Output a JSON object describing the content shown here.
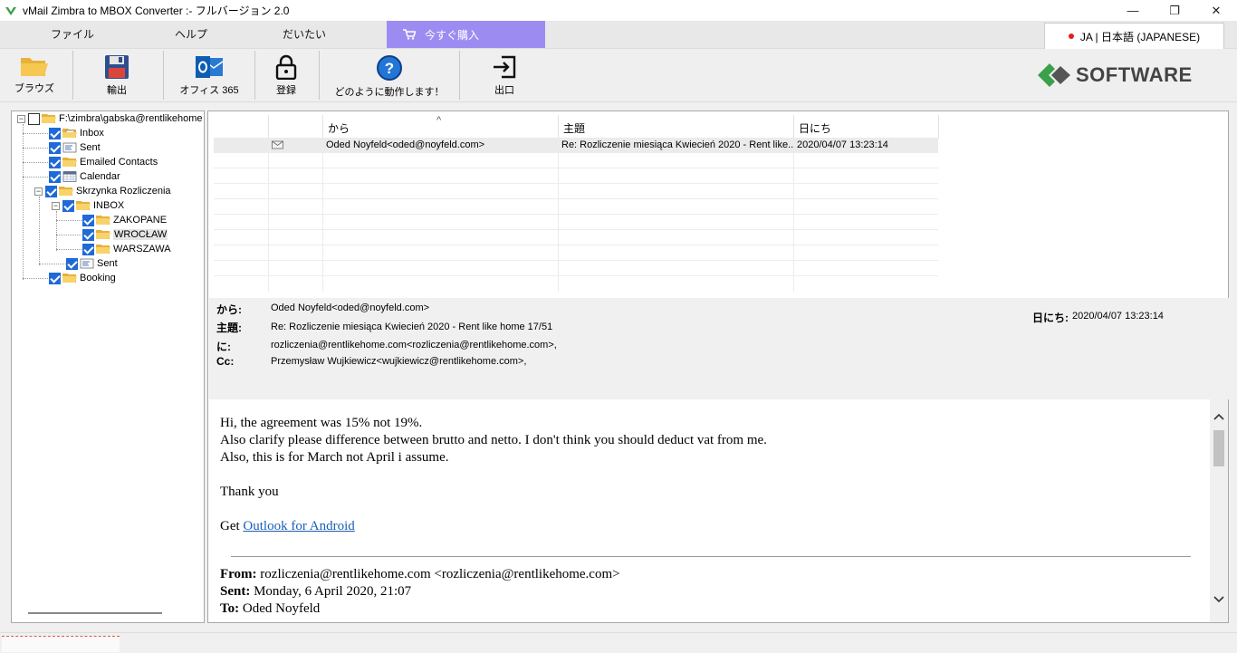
{
  "window": {
    "title": "vMail Zimbra to MBOX Converter :- フルバージョン 2.0",
    "minimize": "—",
    "restore": "❐",
    "close": "✕"
  },
  "menu": {
    "items": [
      "ファイル",
      "ヘルプ",
      "だいたい"
    ],
    "buy_now": "今すぐ購入",
    "language": "JA | 日本語 (JAPANESE)"
  },
  "toolbar": {
    "browse": "ブラウズ",
    "export": "輸出",
    "office365": "オフィス 365",
    "register": "登録",
    "how_it_works": "どのように動作します！",
    "exit": "出口",
    "logo_text": "SOFTWARE"
  },
  "tree": {
    "root": "F:\\zimbra\\gabska@rentlikehome",
    "items": [
      "Inbox",
      "Sent",
      "Emailed Contacts",
      "Calendar",
      "Skrzynka Rozliczenia",
      "INBOX",
      "ZAKOPANE",
      "WROCŁAW",
      "WARSZAWA",
      "Sent",
      "Booking"
    ]
  },
  "grid": {
    "headers": {
      "from": "から",
      "subject": "主題",
      "date": "日にち",
      "sort_indicator": "^"
    },
    "rows": [
      {
        "from": "Oded Noyfeld<oded@noyfeld.com>",
        "subject": "Re: Rozliczenie miesiąca Kwiecień 2020 - Rent like...",
        "date": "2020/04/07 13:23:14"
      }
    ]
  },
  "detail": {
    "from_label": "から:",
    "from": "Oded Noyfeld<oded@noyfeld.com>",
    "subject_label": "主題:",
    "subject": "Re: Rozliczenie miesiąca Kwiecień 2020 - Rent like home 17/51",
    "to_label": "に:",
    "to": "rozliczenia@rentlikehome.com<rozliczenia@rentlikehome.com>,",
    "cc_label": "Cc:",
    "cc": "Przemysław Wujkiewicz<wujkiewicz@rentlikehome.com>,",
    "date_label": "日にち:",
    "date": "2020/04/07 13:23:14"
  },
  "body": {
    "line1": "Hi, the agreement was 15% not 19%.",
    "line2": "Also clarify please difference between brutto and netto. I don't think you should deduct vat from me.",
    "line3": "Also, this is for March not April i assume.",
    "thanks": "Thank you",
    "get_prefix": "Get ",
    "get_link": "Outlook for Android",
    "q_from_label": "From:",
    "q_from": " rozliczenia@rentlikehome.com <rozliczenia@rentlikehome.com>",
    "q_sent_label": "Sent:",
    "q_sent": " Monday, 6 April 2020, 21:07",
    "q_to_label": "To:",
    "q_to": " Oded Noyfeld"
  }
}
